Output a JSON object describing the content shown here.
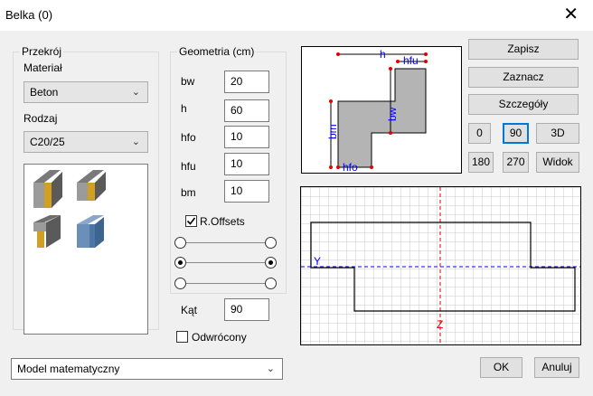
{
  "window": {
    "title": "Belka (0)",
    "close_glyph": "✕"
  },
  "section": {
    "legend": "Przekrój",
    "material_label": "Materiał",
    "material_value": "Beton",
    "kind_label": "Rodzaj",
    "kind_value": "C20/25"
  },
  "geometry": {
    "legend": "Geometria (cm)",
    "fields": [
      {
        "label": "bw",
        "value": "20"
      },
      {
        "label": "h",
        "value": "60"
      },
      {
        "label": "hfo",
        "value": "10"
      },
      {
        "label": "hfu",
        "value": "10"
      },
      {
        "label": "bm",
        "value": "10"
      }
    ],
    "r_offsets_label": "R.Offsets",
    "r_offsets_checked": true,
    "angle_label": "Kąt",
    "angle_value": "90",
    "reversed_label": "Odwrócony",
    "reversed_checked": false
  },
  "buttons": {
    "save": "Zapisz",
    "mark": "Zaznacz",
    "details": "Szczegóły",
    "rot0": "0",
    "rot90": "90",
    "view3d": "3D",
    "rot180": "180",
    "rot270": "270",
    "view": "Widok",
    "ok": "OK",
    "cancel": "Anuluj"
  },
  "preview_labels": {
    "h": "h",
    "hfu": "hfu",
    "bw": "bw",
    "bm": "bm",
    "hfo": "hfo"
  },
  "grid_labels": {
    "y": "Y",
    "z": "Z"
  },
  "model": {
    "value": "Model matematyczny"
  },
  "colors": {
    "accent": "#0078d7",
    "section_fill": "#b4b4b4",
    "dim_blue": "#0000ff",
    "dim_red": "#e00000"
  }
}
